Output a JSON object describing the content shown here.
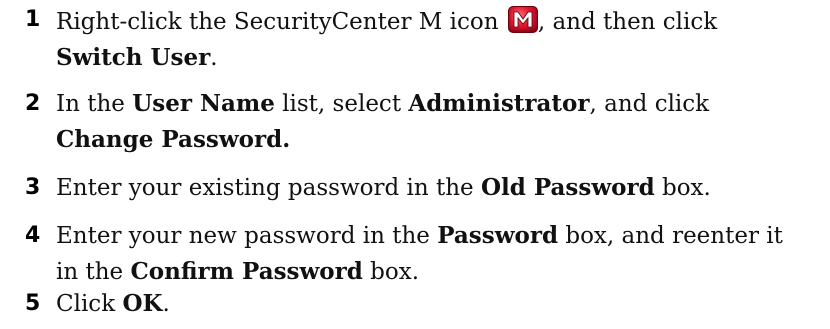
{
  "steps": [
    {
      "number": "1",
      "parts": {
        "a": "Right-click the SecurityCenter M icon ",
        "b": ", and then click",
        "c": "Switch User",
        "d": "."
      },
      "icon": "mcafee-m-icon"
    },
    {
      "number": "2",
      "parts": {
        "a": "In the ",
        "b": "User Name",
        "c": " list, select ",
        "d": "Administrator",
        "e": ", and click",
        "f": "Change Password."
      }
    },
    {
      "number": "3",
      "parts": {
        "a": "Enter your existing password in the ",
        "b": "Old Password",
        "c": " box."
      }
    },
    {
      "number": "4",
      "parts": {
        "a": "Enter your new password in the ",
        "b": "Password",
        "c": " box, and reenter it",
        "d": "in the ",
        "e": "Confirm Password",
        "f": " box."
      }
    },
    {
      "number": "5",
      "parts": {
        "a": "Click ",
        "b": "OK",
        "c": "."
      }
    }
  ],
  "colors": {
    "icon_red": "#e0142b",
    "text": "#111111"
  }
}
